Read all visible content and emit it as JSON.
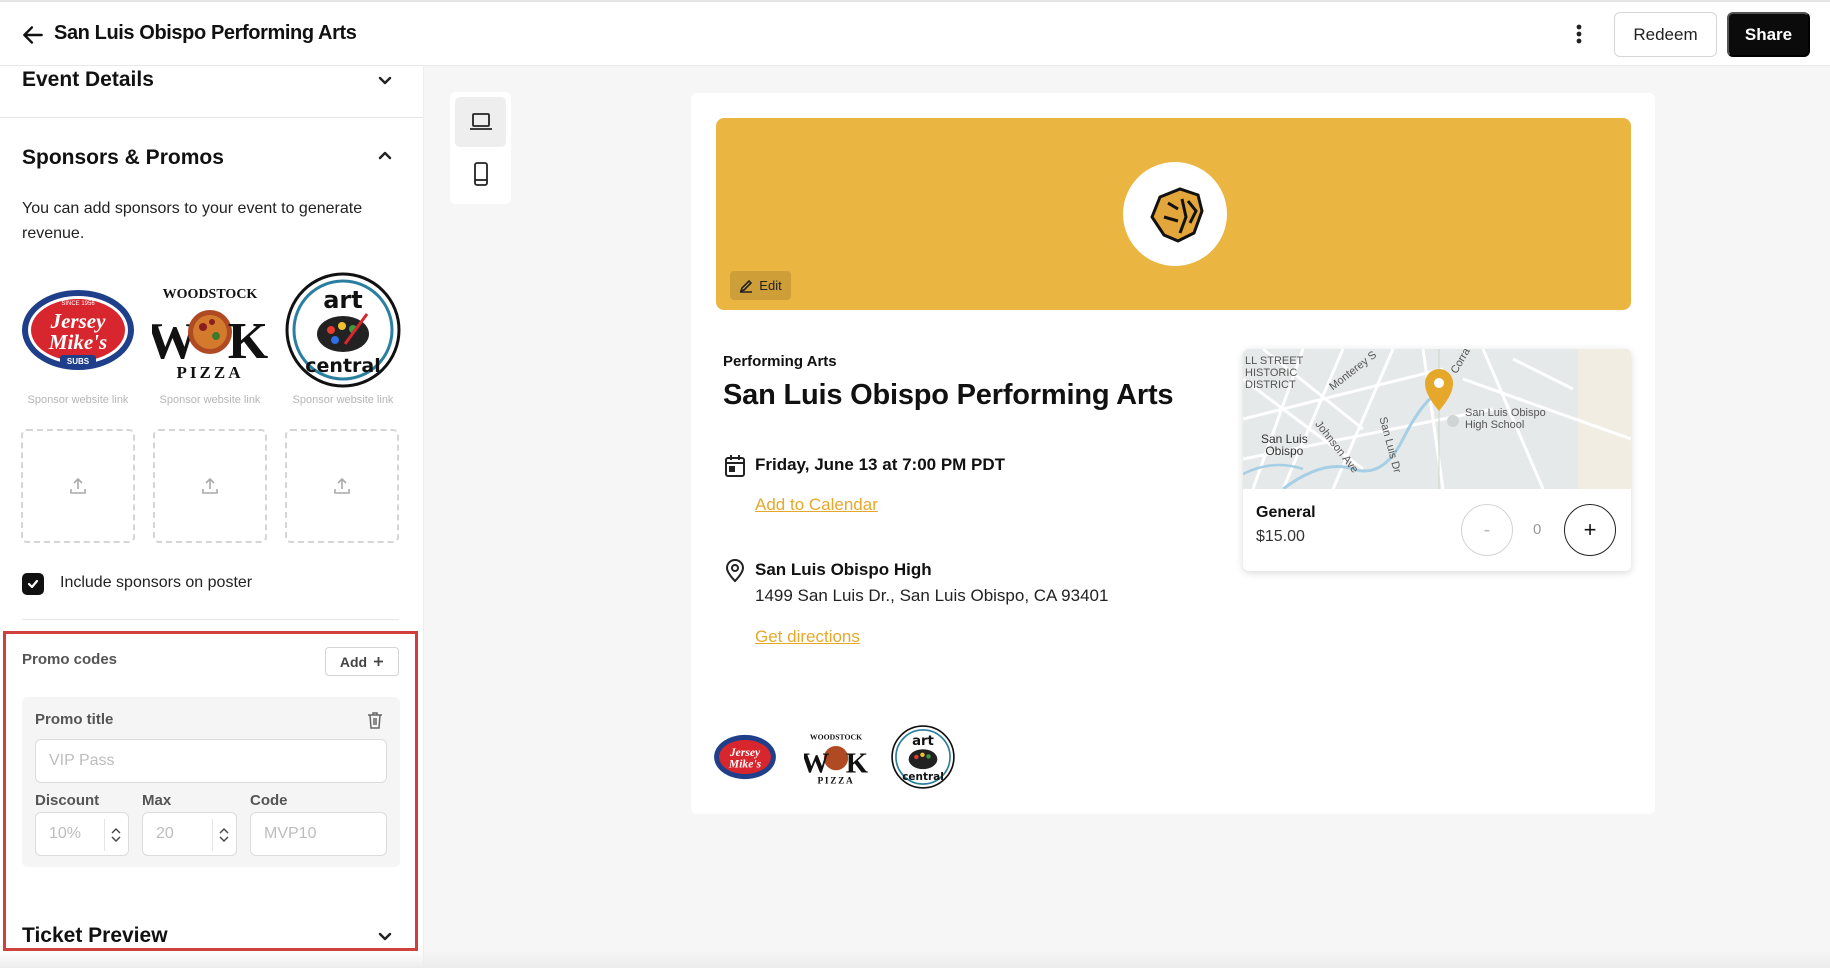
{
  "header": {
    "title": "San Luis Obispo Performing Arts",
    "redeem_label": "Redeem",
    "share_label": "Share"
  },
  "left_panel": {
    "event_details_heading": "Event Details",
    "sponsors_heading": "Sponsors & Promos",
    "sponsors_description": "You can add sponsors to your event to generate revenue.",
    "sponsors": [
      {
        "logo": "jersey-mikes-logo",
        "caption": "Sponsor website link"
      },
      {
        "logo": "woodstock-pizza-logo",
        "caption": "Sponsor website link"
      },
      {
        "logo": "art-central-logo",
        "caption": "Sponsor website link"
      }
    ],
    "logo_text": {
      "jersey_since": "SINCE 1956",
      "jersey_line1": "Jersey",
      "jersey_line2": "Mike's",
      "jersey_subs": "SUBS",
      "woodstock_top": "WOODSTOCK",
      "woodstock_w": "W",
      "woodstock_k": "K",
      "woodstock_pizza": "PIZZA",
      "art_top": "art",
      "art_bottom": "central"
    },
    "include_sponsors_label": "Include sponsors on poster",
    "include_sponsors_checked": true,
    "promo_codes_label": "Promo codes",
    "add_label": "Add",
    "promo": {
      "title_label": "Promo title",
      "title_placeholder": "VIP Pass",
      "discount_label": "Discount",
      "discount_placeholder": "10%",
      "max_label": "Max",
      "max_placeholder": "20",
      "code_label": "Code",
      "code_placeholder": "MVP10"
    },
    "ticket_preview_heading": "Ticket Preview"
  },
  "preview": {
    "banner_color": "#EBB541",
    "edit_label": "Edit",
    "category": "Performing Arts",
    "event_title": "San Luis Obispo Performing Arts",
    "date_text": "Friday, June 13 at 7:00 PM PDT",
    "add_to_calendar": "Add to Calendar",
    "venue_name": "San Luis Obispo High",
    "venue_address": "1499 San Luis Dr., San Luis Obispo, CA 93401",
    "get_directions": "Get directions",
    "link_color": "#E6A82A",
    "map_labels": {
      "district": "LL STREET\nHISTORIC\nDISTRICT",
      "monterey": "Monterey S",
      "city": "San Luis\nObispo",
      "johnson": "Johnson Ave",
      "sld": "San Luis Dr",
      "school": "San Luis Obispo\nHigh School",
      "corral": "Corra"
    },
    "ticket": {
      "name": "General",
      "price": "$15.00",
      "quantity": "0",
      "minus": "-",
      "plus": "+"
    }
  }
}
